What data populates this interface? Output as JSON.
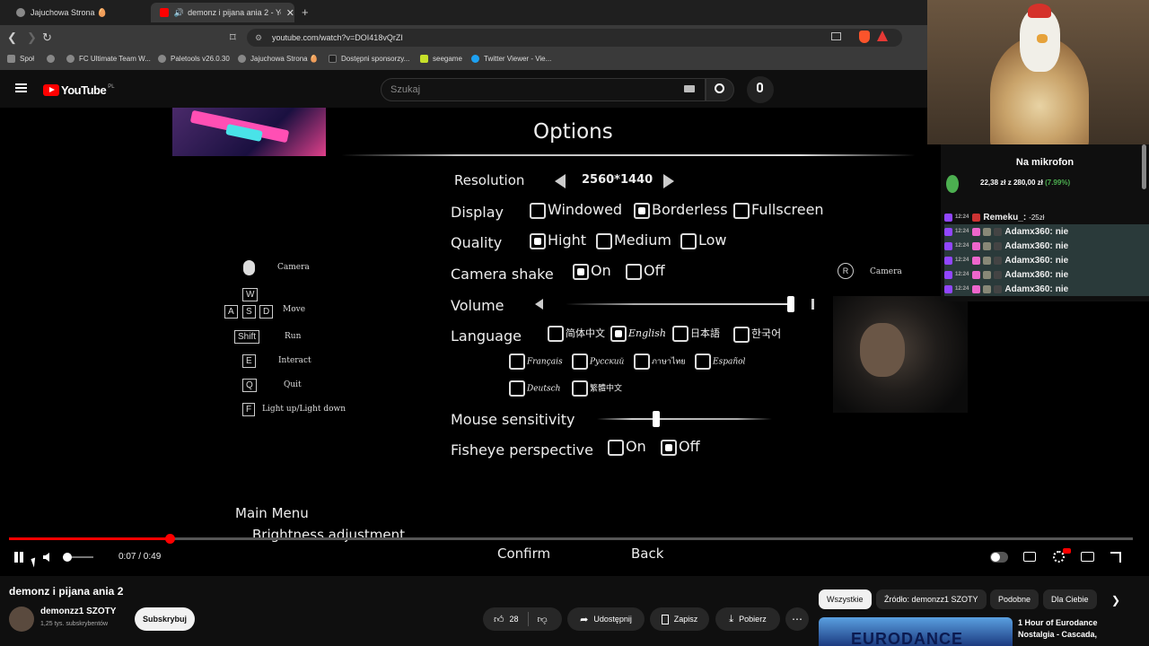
{
  "browser": {
    "tabs": [
      {
        "title": "Jajuchowa Strona 🥚"
      },
      {
        "title": "demonz i pijana ania 2 - YouT"
      }
    ],
    "url": "youtube.com/watch?v=DOI418vQrZI",
    "bookmarks": [
      "Społ",
      "FC Ultimate Team W...",
      "Paletools v26.0.30",
      "Jajuchowa Strona 🥚",
      "Dostępni sponsorzy...",
      "seegame",
      "Twitter Viewer - Vie..."
    ]
  },
  "youtube": {
    "logo": "YouTube",
    "region": "PL",
    "search_placeholder": "Szukaj"
  },
  "game": {
    "title": "Options",
    "resolution_label": "Resolution",
    "resolution_value": "2560*1440",
    "display_label": "Display",
    "display_options": [
      "Windowed",
      "Borderless",
      "Fullscreen"
    ],
    "quality_label": "Quality",
    "quality_options": [
      "Hight",
      "Medium",
      "Low"
    ],
    "camera_shake_label": "Camera shake",
    "on": "On",
    "off": "Off",
    "volume_label": "Volume",
    "language_label": "Language",
    "languages": [
      "简体中文",
      "English",
      "日本語",
      "한국어",
      "Français",
      "Русский",
      "ภาษาไทย",
      "Español",
      "Deutsch",
      "繁體中文"
    ],
    "mouse_label": "Mouse sensitivity",
    "fisheye_label": "Fisheye perspective",
    "controls": {
      "camera": "Camera",
      "move": "Move",
      "run": "Run",
      "interact": "Interact",
      "quit": "Quit",
      "light": "Light up/Light down",
      "keys": {
        "w": "W",
        "a": "A",
        "s": "S",
        "d": "D",
        "shift": "Shift",
        "e": "E",
        "q": "Q",
        "f": "F"
      },
      "right_key": "R",
      "right_label": "Camera"
    },
    "main_menu": "Main Menu",
    "brightness": "Brightness adjustment",
    "confirm": "Confirm",
    "back": "Back"
  },
  "player": {
    "time": "0:07 / 0:49",
    "progress_fraction": 0.143
  },
  "video": {
    "title": "demonz i pijana ania 2",
    "channel": "demonzz1 SZOTY",
    "subscribers": "1,25 tys. subskrybentów",
    "subscribe": "Subskrybuj",
    "likes": "28",
    "share": "Udostępnij",
    "save": "Zapisz",
    "download": "Pobierz"
  },
  "chips": [
    "Wszystkie",
    "Źródło: demonzz1 SZOTY",
    "Podobne",
    "Dla Ciebie"
  ],
  "recommended": {
    "title_line1": "1 Hour of Eurodance",
    "title_line2": "Nostalgia - Cascada,",
    "thumb_text": "EURODANCE"
  },
  "stream": {
    "goal_title": "Na mikrofon",
    "goal_amount": "22,38 zł",
    "goal_of": "z",
    "goal_target": "280,00 zł",
    "goal_percent": "(7.99%)",
    "chat": [
      {
        "time": "12:24",
        "user": "Remeku_:",
        "msg": "-25zł"
      },
      {
        "time": "12:24",
        "user": "Adamx360:",
        "msg": "nie"
      },
      {
        "time": "12:24",
        "user": "Adamx360:",
        "msg": "nie"
      },
      {
        "time": "12:24",
        "user": "Adamx360:",
        "msg": "nie"
      },
      {
        "time": "12:24",
        "user": "Adamx360:",
        "msg": "nie"
      },
      {
        "time": "12:24",
        "user": "Adamx360:",
        "msg": "nie"
      }
    ]
  },
  "colors": {
    "accent": "#ff0000",
    "goal_green": "#4caf50",
    "twitch_purple": "#9146ff"
  }
}
